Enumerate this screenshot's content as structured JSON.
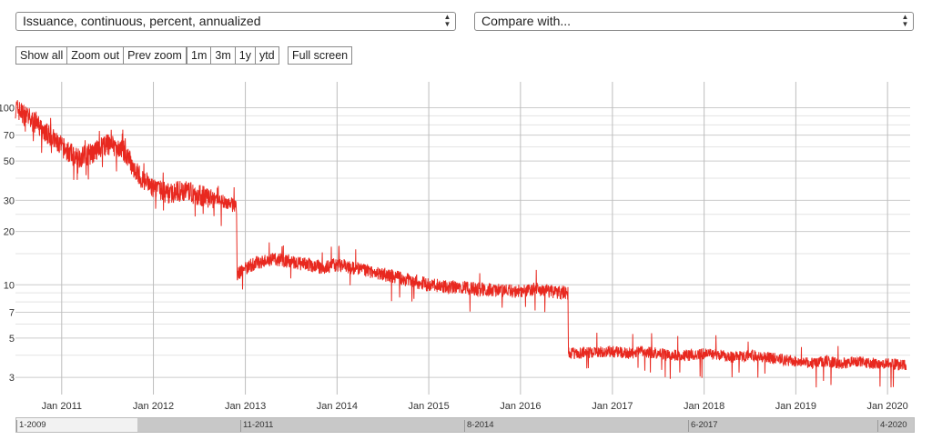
{
  "controls": {
    "metric_select": "Issuance, continuous, percent, annualized",
    "compare_select": "Compare with...",
    "zoom_buttons": [
      "Show all",
      "Zoom out",
      "Prev zoom"
    ],
    "range_buttons": [
      "1m",
      "3m",
      "1y",
      "ytd"
    ],
    "fullscreen_button": "Full screen"
  },
  "icons": {
    "select_arrow": "updown-arrow-icon"
  },
  "colors": {
    "series": "#e8281f",
    "grid": "#cccccc",
    "grid_minor": "#e3e3e3",
    "navigator_selected": "#c8c8c8"
  },
  "navigator": {
    "labels": [
      "1-2009",
      "11-2011",
      "8-2014",
      "6-2017",
      "4-2020"
    ]
  },
  "chart_data": {
    "type": "line",
    "title": "",
    "xlabel": "",
    "ylabel": "",
    "y_scale": "log",
    "x_range": [
      "2010-07-01",
      "2020-03-31"
    ],
    "y_range": [
      2.4,
      140
    ],
    "x_ticks": [
      "Jan 2011",
      "Jan 2012",
      "Jan 2013",
      "Jan 2014",
      "Jan 2015",
      "Jan 2016",
      "Jan 2017",
      "Jan 2018",
      "Jan 2019",
      "Jan 2020"
    ],
    "y_ticks": [
      3,
      5,
      7,
      10,
      20,
      30,
      50,
      70,
      100
    ],
    "grid": true,
    "legend": "none",
    "series": [
      {
        "x": [
          "2010-07-01",
          "2010-09-01",
          "2010-11-01",
          "2011-01-01",
          "2011-03-01",
          "2011-05-01",
          "2011-07-01",
          "2011-09-01",
          "2011-11-01",
          "2012-01-01",
          "2012-03-01",
          "2012-05-01",
          "2012-07-01",
          "2012-09-01",
          "2012-11-01",
          "2012-11-27",
          "2012-11-29",
          "2013-01-01",
          "2013-03-01",
          "2013-05-01",
          "2013-07-01",
          "2013-09-01",
          "2013-11-01",
          "2014-01-01",
          "2014-03-01",
          "2014-05-01",
          "2014-07-01",
          "2014-09-01",
          "2014-11-01",
          "2015-01-01",
          "2015-03-01",
          "2015-05-01",
          "2015-07-01",
          "2015-09-01",
          "2015-11-01",
          "2016-01-01",
          "2016-03-01",
          "2016-05-01",
          "2016-07-08",
          "2016-07-10",
          "2016-09-01",
          "2016-11-01",
          "2017-01-01",
          "2017-03-01",
          "2017-05-01",
          "2017-07-01",
          "2017-09-01",
          "2017-11-01",
          "2018-01-01",
          "2018-03-01",
          "2018-05-01",
          "2018-07-01",
          "2018-09-01",
          "2018-11-01",
          "2019-01-01",
          "2019-03-01",
          "2019-05-01",
          "2019-07-01",
          "2019-09-01",
          "2019-11-01",
          "2020-01-01",
          "2020-03-15"
        ],
        "y": [
          100,
          85,
          72,
          60,
          52,
          55,
          62,
          58,
          42,
          35,
          33,
          34,
          32,
          30,
          29,
          27,
          11.5,
          12.5,
          13.5,
          14,
          13.5,
          13,
          12.5,
          13,
          12.5,
          12,
          11.5,
          11,
          10.5,
          10,
          9.8,
          9.6,
          9.5,
          9.4,
          9.3,
          9.2,
          9.5,
          9.2,
          9.0,
          4.1,
          4.1,
          4.2,
          4.2,
          4.1,
          4.2,
          4.1,
          4.0,
          4.0,
          4.1,
          4.0,
          3.9,
          4.0,
          3.9,
          3.8,
          3.7,
          3.6,
          3.7,
          3.6,
          3.7,
          3.6,
          3.6,
          3.5
        ]
      }
    ]
  }
}
